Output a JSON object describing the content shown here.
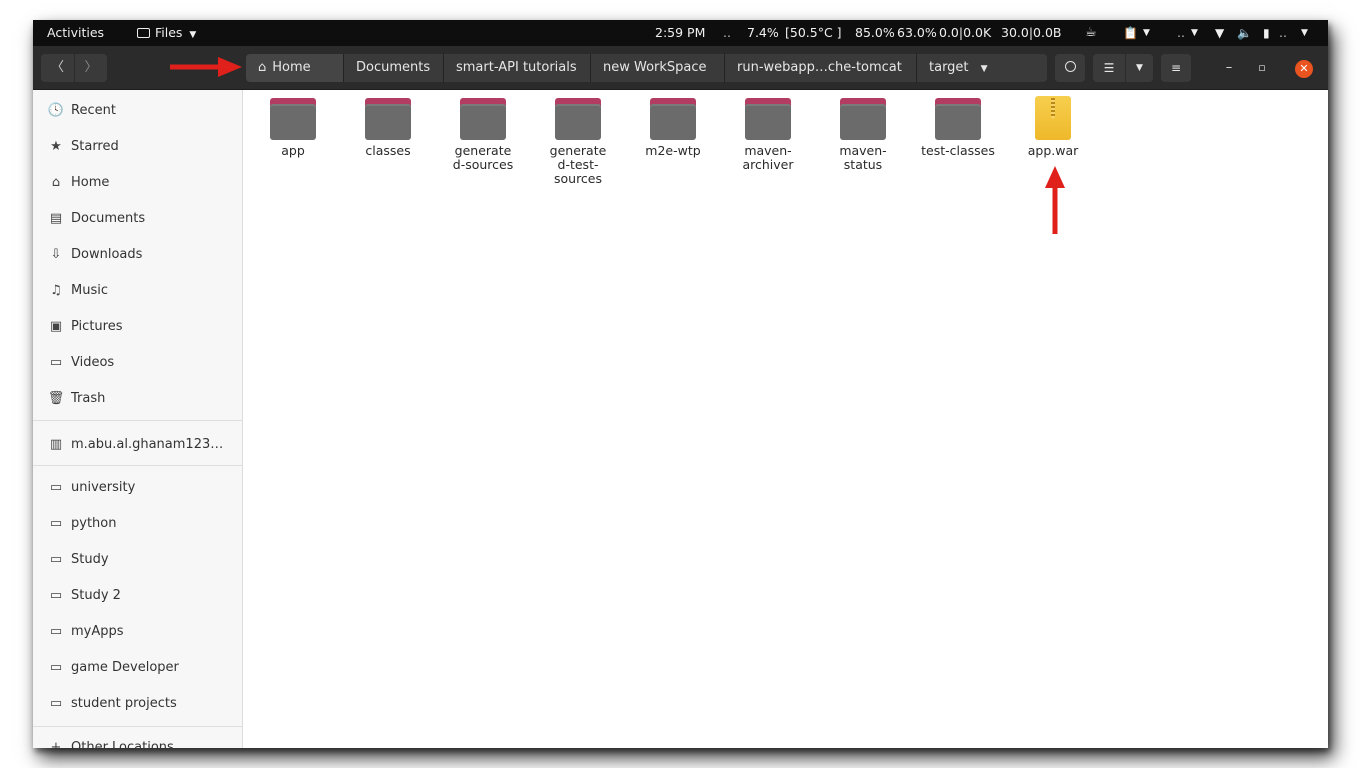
{
  "topbar": {
    "activities": "Activities",
    "app_menu": "Files",
    "clock": "2:59 PM",
    "dots1": "..",
    "cpu": "7.4%",
    "temp": "[50.5°C ]",
    "mem": "85.0%",
    "swap": "63.0%",
    "net": "0.0|0.0K",
    "disk": "30.0|0.0B",
    "dots2": "..",
    "dots3": ".."
  },
  "breadcrumbs": [
    {
      "label": "Home"
    },
    {
      "label": "Documents"
    },
    {
      "label": "smart-API tutorials"
    },
    {
      "label": "new WorkSpace"
    },
    {
      "label": "run-webapp…che-tomcat"
    },
    {
      "label": "target"
    }
  ],
  "sidebar": {
    "items": [
      {
        "label": "Recent",
        "icon": "clock-icon"
      },
      {
        "label": "Starred",
        "icon": "star-icon"
      },
      {
        "label": "Home",
        "icon": "home-icon"
      },
      {
        "label": "Documents",
        "icon": "document-icon"
      },
      {
        "label": "Downloads",
        "icon": "download-icon"
      },
      {
        "label": "Music",
        "icon": "music-icon"
      },
      {
        "label": "Pictures",
        "icon": "picture-icon"
      },
      {
        "label": "Videos",
        "icon": "video-icon"
      },
      {
        "label": "Trash",
        "icon": "trash-icon"
      }
    ],
    "network": {
      "label": "m.abu.al.ghanam123…",
      "icon": "network-drive-icon"
    },
    "bookmarks": [
      {
        "label": "university"
      },
      {
        "label": "python"
      },
      {
        "label": "Study"
      },
      {
        "label": "Study 2"
      },
      {
        "label": "myApps"
      },
      {
        "label": "game Developer"
      },
      {
        "label": "student projects"
      }
    ],
    "other": {
      "label": "Other Locations"
    }
  },
  "files": [
    {
      "name": "app",
      "type": "folder"
    },
    {
      "name": "classes",
      "type": "folder"
    },
    {
      "name": "generated-sources",
      "type": "folder"
    },
    {
      "name": "generated-test-sources",
      "type": "folder"
    },
    {
      "name": "m2e-wtp",
      "type": "folder"
    },
    {
      "name": "maven-archiver",
      "type": "folder"
    },
    {
      "name": "maven-status",
      "type": "folder"
    },
    {
      "name": "test-classes",
      "type": "folder"
    },
    {
      "name": "app.war",
      "type": "archive"
    }
  ],
  "colors": {
    "accent_close": "#e95420",
    "folder_tab": "#b33d62",
    "folder_body": "#6b6b6b",
    "archive": "#f4c63c",
    "annotation_arrow": "#e0201a"
  }
}
